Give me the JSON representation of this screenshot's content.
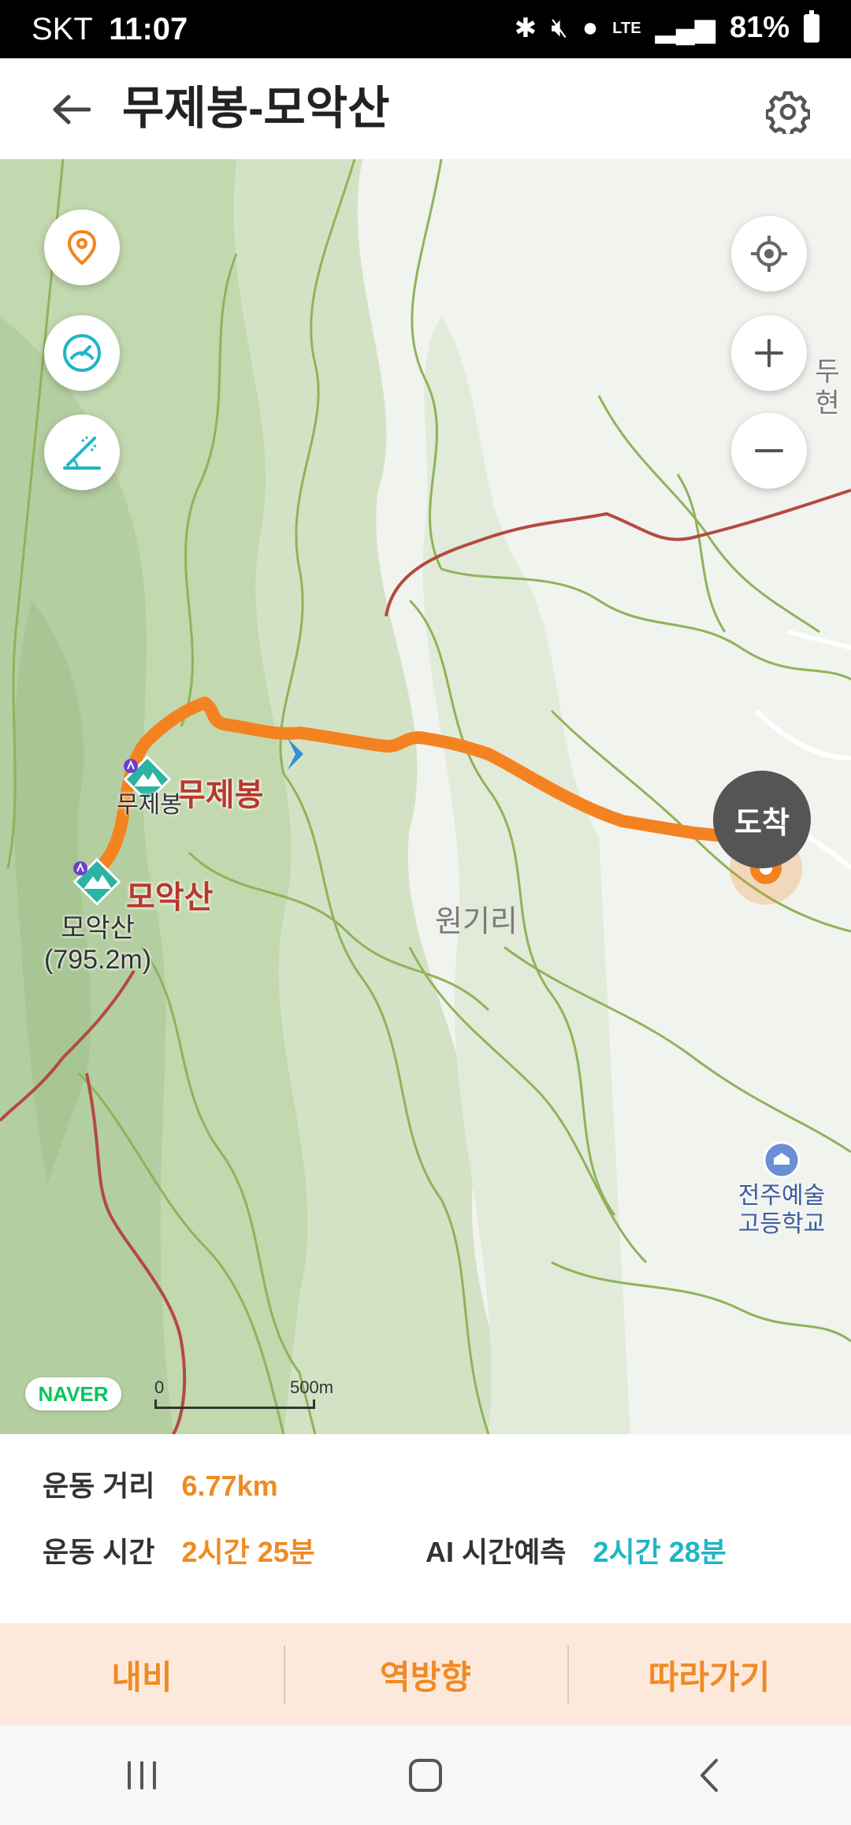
{
  "status_bar": {
    "carrier": "SKT",
    "time": "11:07",
    "network": "LTE",
    "battery": "81%"
  },
  "header": {
    "title": "무제봉-모악산",
    "back_icon": "arrow-left-icon",
    "settings_icon": "gear-icon"
  },
  "map": {
    "peaks": [
      {
        "name": "무제봉",
        "sub_label": "무제봉"
      },
      {
        "name": "모악산",
        "sub_label": "모악산",
        "elevation": "(795.2m)"
      }
    ],
    "village": "원기리",
    "edge_label": "두현",
    "school": "전주예술 고등학교",
    "arrive_label": "도착",
    "brand": "NAVER",
    "scale": {
      "zero": "0",
      "length": "500m"
    },
    "colors": {
      "route": "#f58220",
      "trail": "#8fb35a",
      "road": "#b54a3f",
      "accent_teal": "#1fb6c4"
    }
  },
  "stats": {
    "distance_label": "운동 거리",
    "distance_value": "6.77km",
    "time_label": "운동 시간",
    "time_value": "2시간 25분",
    "ai_label": "AI 시간예측",
    "ai_value": "2시간 28분"
  },
  "actions": {
    "navi": "내비",
    "reverse": "역방향",
    "follow": "따라가기"
  }
}
